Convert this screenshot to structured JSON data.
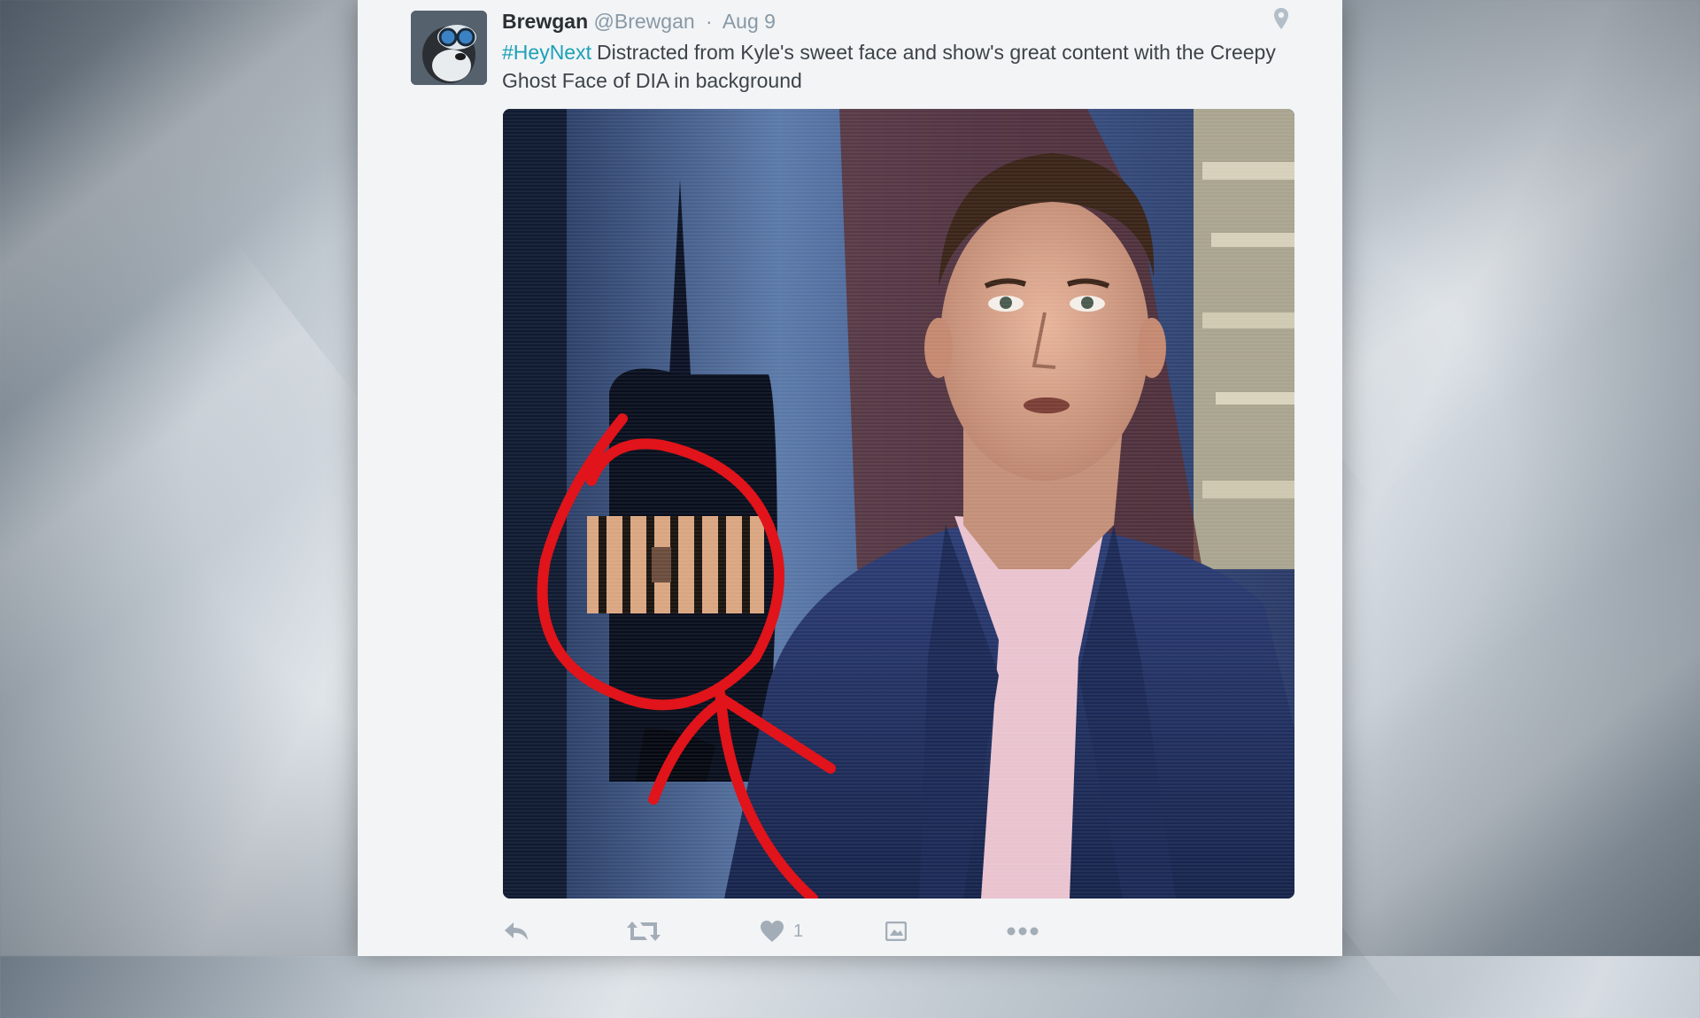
{
  "tweet": {
    "author_name": "Brewgan",
    "author_handle": "@Brewgan",
    "separator": "·",
    "date": "Aug 9",
    "hashtag": "#HeyNext",
    "text": "Distracted from Kyle's sweet face and show's great content with the Creepy Ghost Face of DIA in background",
    "like_count": "1"
  },
  "icons": {
    "location": "location-pin-icon",
    "reply": "reply-icon",
    "retweet": "retweet-icon",
    "like": "heart-icon",
    "moments": "moments-icon",
    "more": "more-dots-icon"
  },
  "colors": {
    "hashtag": "#1da1b6",
    "annotation": "#e0141a",
    "action_gray": "#a3adb7"
  }
}
